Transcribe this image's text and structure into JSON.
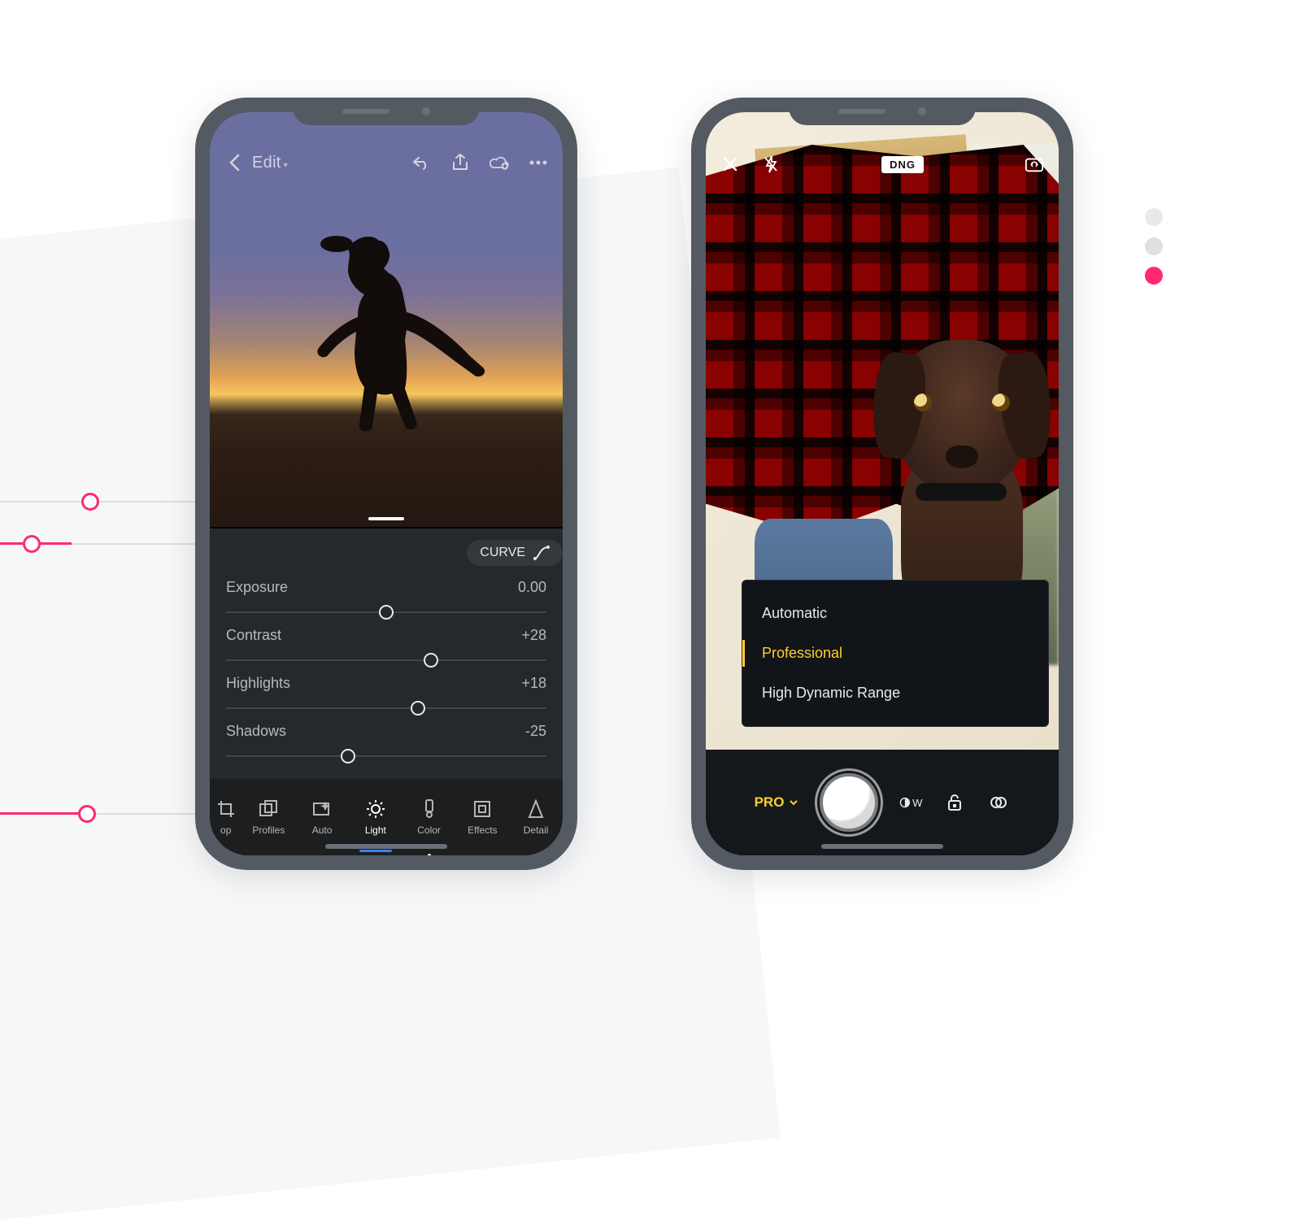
{
  "phone1": {
    "header": {
      "title": "Edit",
      "back_icon": "chevron-left",
      "undo_icon": "undo",
      "share_icon": "share",
      "cloud_icon": "cloud-plus",
      "more_icon": "more"
    },
    "curve_button": "CURVE",
    "sliders": [
      {
        "label": "Exposure",
        "value": "0.00",
        "pos": 50
      },
      {
        "label": "Contrast",
        "value": "+28",
        "pos": 64
      },
      {
        "label": "Highlights",
        "value": "+18",
        "pos": 60
      },
      {
        "label": "Shadows",
        "value": "-25",
        "pos": 38
      }
    ],
    "tools": [
      {
        "label": "op",
        "icon": "crop",
        "active": false
      },
      {
        "label": "Profiles",
        "icon": "profiles",
        "active": false
      },
      {
        "label": "Auto",
        "icon": "auto",
        "active": false
      },
      {
        "label": "Light",
        "icon": "light",
        "active": true
      },
      {
        "label": "Color",
        "icon": "color",
        "active": false,
        "dot": true
      },
      {
        "label": "Effects",
        "icon": "effects",
        "active": false
      },
      {
        "label": "Detail",
        "icon": "detail",
        "active": false
      }
    ]
  },
  "phone2": {
    "header": {
      "close_icon": "close",
      "flash_icon": "flash-off",
      "format_badge": "DNG",
      "switch_icon": "camera-switch"
    },
    "mode_menu": [
      {
        "label": "Automatic",
        "active": false
      },
      {
        "label": "Professional",
        "active": true
      },
      {
        "label": "High Dynamic Range",
        "active": false
      }
    ],
    "camera_bar": {
      "mode_label": "PRO",
      "wb_label": "W",
      "lock_icon": "lock-open",
      "filter_icon": "filter"
    }
  },
  "decor": {
    "dots": [
      "#e9e9eb",
      "#e0e0e2",
      "#ff2a6d"
    ]
  }
}
